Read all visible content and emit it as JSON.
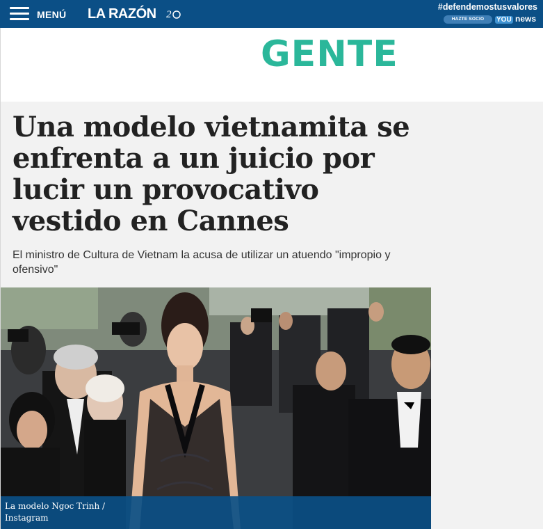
{
  "topbar": {
    "menu_label": "MENÚ",
    "logo_text": "LA RAZÓN",
    "hashtag": "#defendemostusvalores",
    "hazte_label": "HAZTE SOCIO",
    "you_label": "YOU",
    "news_label": "news",
    "bg_color": "#0b4f86"
  },
  "section": {
    "title": "GENTE",
    "color": "#2bb79a"
  },
  "article": {
    "headline": "Una modelo vietnamita se enfrenta a un juicio por lucir un provocativo vestido en Cannes",
    "subhead": "El ministro de Cultura de Vietnam la acusa de utilizar un atuendo \"impropio y ofensivo\"",
    "image_caption": "La modelo Ngoc Trinh / Instagram"
  }
}
